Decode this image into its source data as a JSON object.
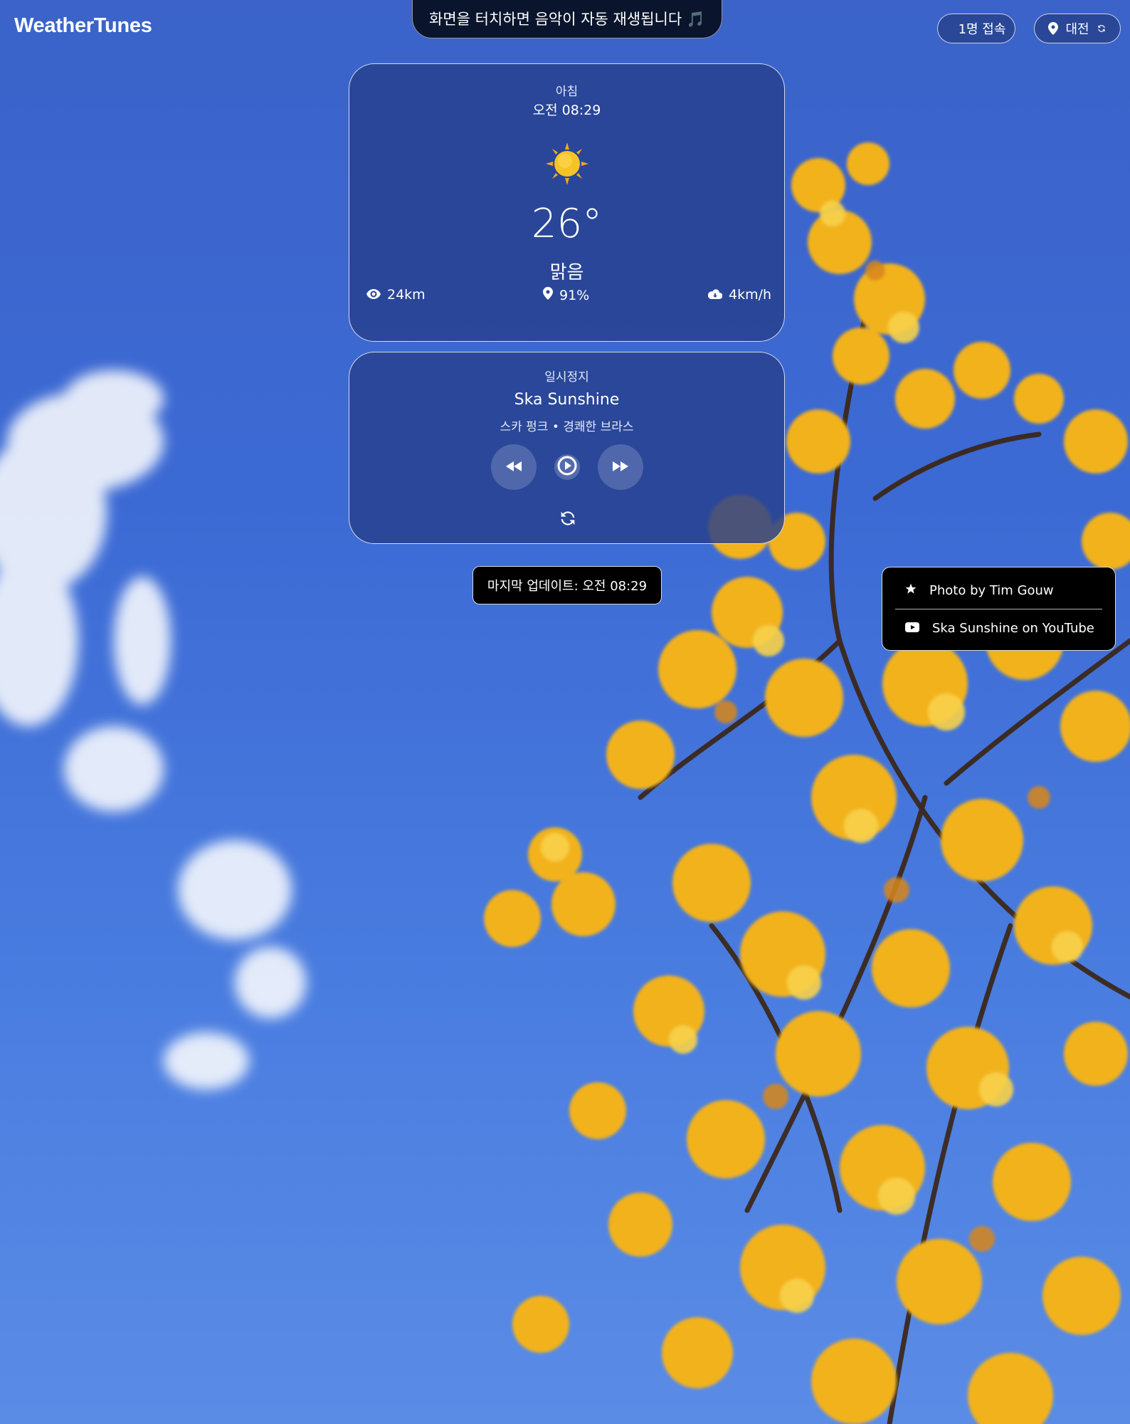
{
  "app": {
    "brand": "WeatherTunes"
  },
  "toast": {
    "text": "화면을 터치하면 음악이 자동 재생됩니다 🎵"
  },
  "header": {
    "users_online": "1명 접속",
    "location": "대전"
  },
  "weather": {
    "period": "아침",
    "time": "오전 08:29",
    "icon": "sun-icon",
    "temperature": "26°",
    "condition": "맑음",
    "visibility": "24km",
    "humidity": "91%",
    "wind": "4km/h"
  },
  "player": {
    "status": "일시정지",
    "track_title": "Ska Sunshine",
    "track_subtitle": "스카 펑크 • 경쾌한 브라스",
    "is_playing": false
  },
  "footer": {
    "last_updated": "마지막 업데이트: 오전 08:29"
  },
  "credits": {
    "photo": "Photo by Tim Gouw",
    "youtube": "Ska Sunshine on YouTube"
  },
  "colors": {
    "sky": "#3c6ad4",
    "card": "#2a468f",
    "leaves": "#f2b21c",
    "sun": "#f6c327"
  }
}
